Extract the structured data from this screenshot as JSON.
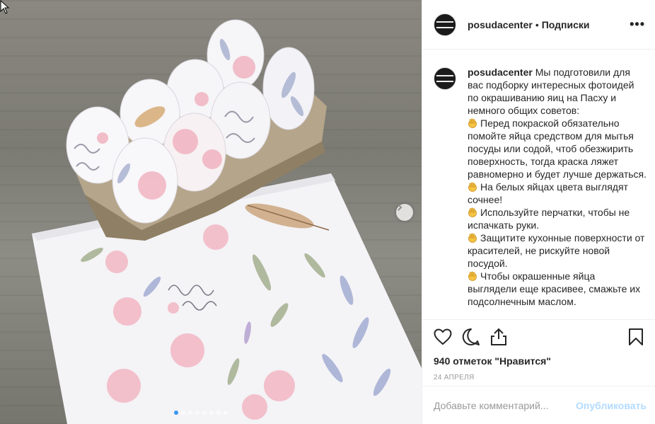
{
  "post": {
    "username": "posudacenter",
    "separator": "•",
    "follow_label": "Подписки",
    "more_label": "•••"
  },
  "caption": {
    "username": "posudacenter",
    "intro": "Мы подготовили для вас подборку интересных фотоидей по окрашиванию яиц на Пасху и немного общих советов:",
    "tips": [
      "Перед покраской обязательно помойте яйца средством для мытья посуды или содой, чтоб обезжирить поверхность, тогда краска ляжет равномерно и будет лучше держаться.",
      "На белых яйцах цвета выглядят сочнее!",
      "Используйте перчатки, чтобы не испачкать руки.",
      "Защитите кухонные поверхности от красителей, не рискуйте новой посудой.",
      "Чтобы окрашенные яйца выглядели еще красивее, смажьте их подсолнечным маслом."
    ],
    "tip_icon": "waving-hand-emoji"
  },
  "actions": {
    "likes": "940 отметок \"Нравится\"",
    "date": "24 АПРЕЛЯ"
  },
  "comment_box": {
    "placeholder": "Добавьте комментарий...",
    "publish_label": "Опубликовать"
  },
  "carousel": {
    "slide_count": 8,
    "active_index": 0
  },
  "colors": {
    "link_blue": "#3897f0",
    "publish_disabled": "#b3dbff",
    "text": "#262626",
    "muted": "#999999"
  }
}
